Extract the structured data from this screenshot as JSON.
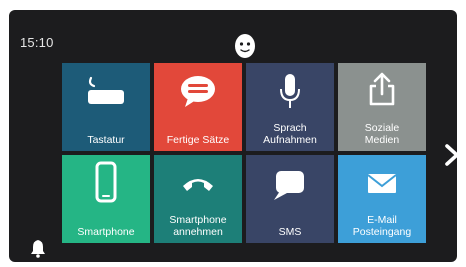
{
  "status": {
    "time": "15:10"
  },
  "tiles": [
    {
      "label_lines": [
        "Tastatur"
      ],
      "color": "#1d5b78",
      "icon": "keyboard-icon"
    },
    {
      "label_lines": [
        "Fertige Sätze"
      ],
      "color": "#e2483a",
      "icon": "speech-bubble-icon"
    },
    {
      "label_lines": [
        "Sprach",
        "Aufnahmen"
      ],
      "color": "#394566",
      "icon": "microphone-icon"
    },
    {
      "label_lines": [
        "Soziale",
        "Medien"
      ],
      "color": "#8b918f",
      "icon": "share-icon"
    },
    {
      "label_lines": [
        "Smartphone"
      ],
      "color": "#25b585",
      "icon": "smartphone-icon"
    },
    {
      "label_lines": [
        "Smartphone",
        "annehmen"
      ],
      "color": "#1d7f78",
      "icon": "phone-handset-icon"
    },
    {
      "label_lines": [
        "SMS"
      ],
      "color": "#394566",
      "icon": "chat-bubble-icon"
    },
    {
      "label_lines": [
        "E-Mail",
        "Posteingang"
      ],
      "color": "#3d9fd8",
      "icon": "mail-icon"
    }
  ],
  "icons": {
    "avatar": "face-icon",
    "bell": "bell-icon",
    "next": "chevron-right-icon"
  }
}
